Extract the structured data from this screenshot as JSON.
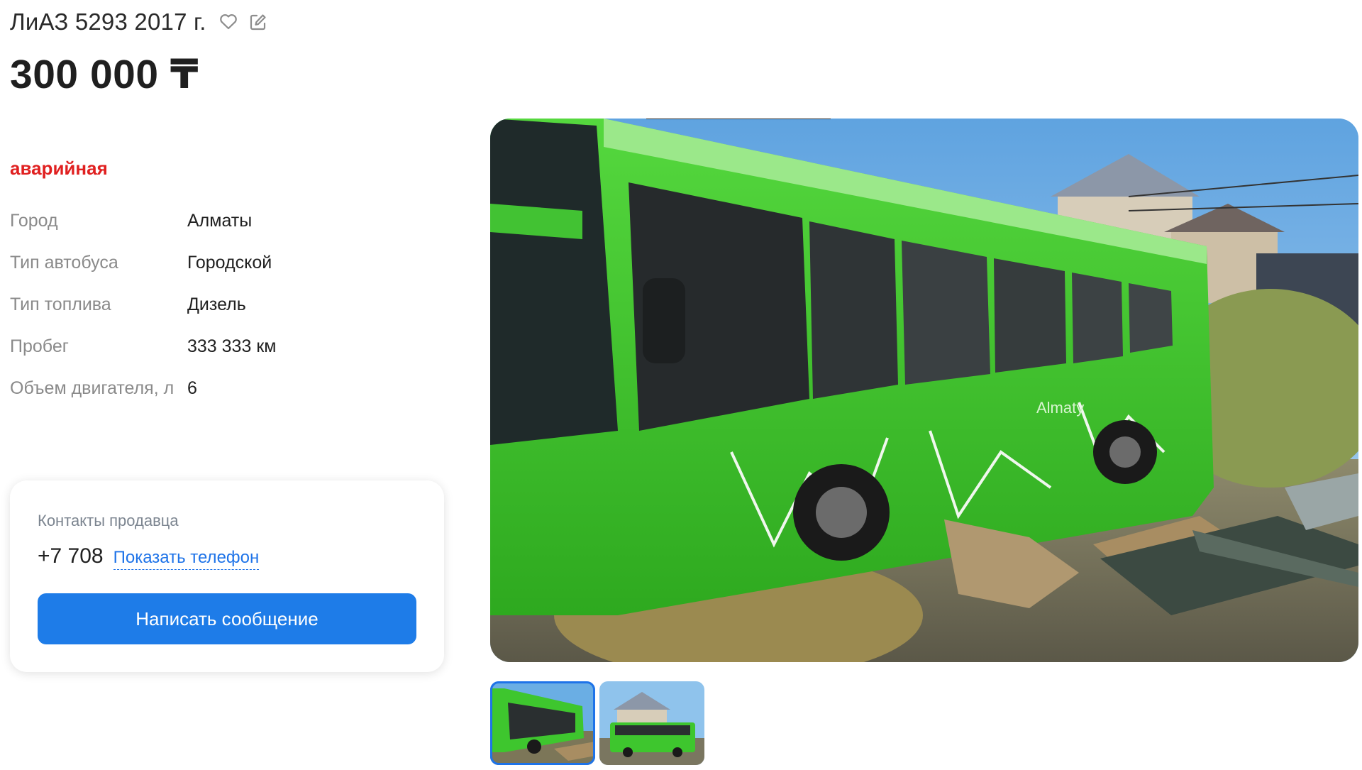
{
  "listing": {
    "title": "ЛиАЗ 5293 2017 г.",
    "price": "300 000 ₸",
    "condition": "аварийная",
    "specs": [
      {
        "label": "Город",
        "value": "Алматы"
      },
      {
        "label": "Тип автобуса",
        "value": "Городской"
      },
      {
        "label": "Тип топлива",
        "value": "Дизель"
      },
      {
        "label": "Пробег",
        "value": "333 333 км"
      },
      {
        "label": "Объем двигателя, л",
        "value": "6"
      }
    ]
  },
  "contact": {
    "label": "Контакты продавца",
    "phone_prefix": "+7 708",
    "show_phone": "Показать телефон",
    "message_button": "Написать сообщение"
  },
  "photo": {
    "bus_logo_text": "Almaty"
  },
  "icons": {
    "favorite": "heart-icon",
    "edit": "edit-icon"
  },
  "colors": {
    "condition": "#e02020",
    "accent": "#1e7ce8",
    "link": "#1e73e8",
    "bus_green": "#3ec62e"
  }
}
